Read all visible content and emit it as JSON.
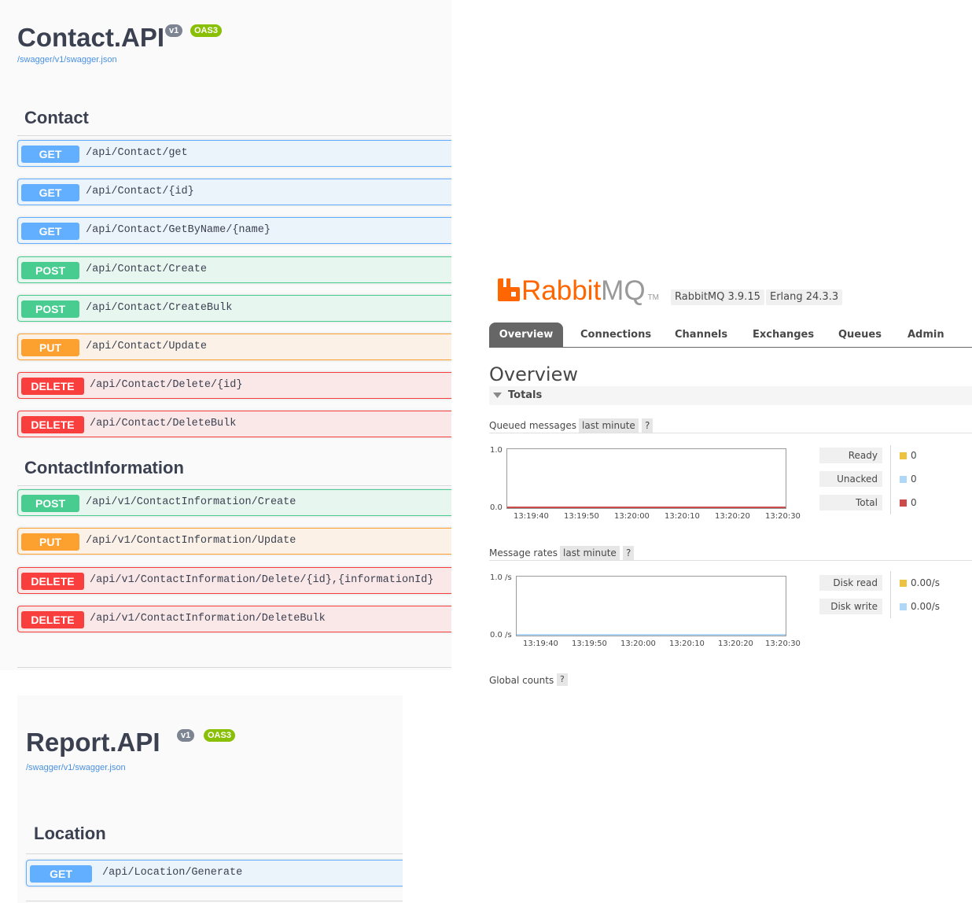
{
  "contact_api": {
    "title": "Contact.API",
    "version": "v1",
    "oas": "OAS3",
    "url": "/swagger/v1/swagger.json",
    "tags": [
      {
        "name": "Contact",
        "operations": [
          {
            "method": "GET",
            "path": "/api/Contact/get"
          },
          {
            "method": "GET",
            "path": "/api/Contact/{id}"
          },
          {
            "method": "GET",
            "path": "/api/Contact/GetByName/{name}"
          },
          {
            "method": "POST",
            "path": "/api/Contact/Create"
          },
          {
            "method": "POST",
            "path": "/api/Contact/CreateBulk"
          },
          {
            "method": "PUT",
            "path": "/api/Contact/Update"
          },
          {
            "method": "DELETE",
            "path": "/api/Contact/Delete/{id}"
          },
          {
            "method": "DELETE",
            "path": "/api/Contact/DeleteBulk"
          }
        ]
      },
      {
        "name": "ContactInformation",
        "operations": [
          {
            "method": "POST",
            "path": "/api/v1/ContactInformation/Create"
          },
          {
            "method": "PUT",
            "path": "/api/v1/ContactInformation/Update"
          },
          {
            "method": "DELETE",
            "path": "/api/v1/ContactInformation/Delete/{id},{informationId}"
          },
          {
            "method": "DELETE",
            "path": "/api/v1/ContactInformation/DeleteBulk"
          }
        ]
      }
    ]
  },
  "report_api": {
    "title": "Report.API",
    "version": "v1",
    "oas": "OAS3",
    "url": "/swagger/v1/swagger.json",
    "tags": [
      {
        "name": "Location",
        "operations": [
          {
            "method": "GET",
            "path": "/api/Location/Generate"
          }
        ]
      }
    ]
  },
  "rabbitmq": {
    "logo_rabbit": "Rabbit",
    "logo_mq": "MQ",
    "logo_tm": "TM",
    "logo_icon": "rabbitmq-logo-icon",
    "rabbitmq_version": "RabbitMQ 3.9.15",
    "erlang_version": "Erlang 24.3.3",
    "tabs": [
      "Overview",
      "Connections",
      "Channels",
      "Exchanges",
      "Queues",
      "Admin"
    ],
    "active_tab": "Overview",
    "page_title": "Overview",
    "totals_label": "Totals",
    "queued": {
      "heading": "Queued messages",
      "range": "last minute",
      "help": "?",
      "y_top": "1.0",
      "y_bottom": "0.0",
      "x_ticks": [
        "13:19:40",
        "13:19:50",
        "13:20:00",
        "13:20:10",
        "13:20:20",
        "13:20:30"
      ],
      "legend": [
        {
          "label": "Ready",
          "value": "0",
          "color": "#edc240"
        },
        {
          "label": "Unacked",
          "value": "0",
          "color": "#afd8f8"
        },
        {
          "label": "Total",
          "value": "0",
          "color": "#cb4b4b"
        }
      ]
    },
    "rates": {
      "heading": "Message rates",
      "range": "last minute",
      "help": "?",
      "y_top": "1.0 /s",
      "y_bottom": "0.0 /s",
      "x_ticks": [
        "13:19:40",
        "13:19:50",
        "13:20:00",
        "13:20:10",
        "13:20:20",
        "13:20:30"
      ],
      "legend": [
        {
          "label": "Disk read",
          "value": "0.00/s",
          "color": "#edc240"
        },
        {
          "label": "Disk write",
          "value": "0.00/s",
          "color": "#afd8f8"
        }
      ]
    },
    "global_counts": {
      "heading": "Global counts",
      "help": "?"
    }
  },
  "colors": {
    "get": "#61affe",
    "post": "#49cc90",
    "put": "#fca130",
    "delete": "#f93e3e",
    "rabbit_orange": "#f60"
  }
}
